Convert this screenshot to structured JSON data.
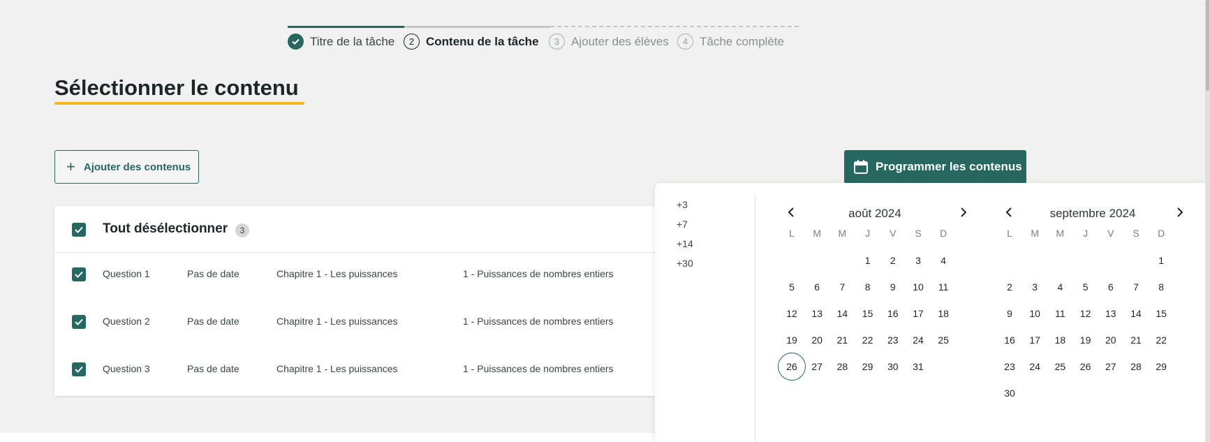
{
  "stepper": {
    "steps": [
      {
        "number": "1",
        "label": "Titre de la tâche",
        "state": "done"
      },
      {
        "number": "2",
        "label": "Contenu de la tâche",
        "state": "active"
      },
      {
        "number": "3",
        "label": "Ajouter des élèves",
        "state": "todo"
      },
      {
        "number": "4",
        "label": "Tâche complète",
        "state": "todo"
      }
    ]
  },
  "page": {
    "title": "Sélectionner le contenu",
    "add_button": "Ajouter des contenus",
    "schedule_button": "Programmer les contenus"
  },
  "table": {
    "header_label": "Tout désélectionner",
    "count": "3",
    "rows": [
      {
        "name": "Question 1",
        "date": "Pas de date",
        "chapter": "Chapitre 1 - Les puissances",
        "section": "1 - Puissances de nombres entiers",
        "checked": true
      },
      {
        "name": "Question 2",
        "date": "Pas de date",
        "chapter": "Chapitre 1 - Les puissances",
        "section": "1 - Puissances de nombres entiers",
        "checked": true
      },
      {
        "name": "Question 3",
        "date": "Pas de date",
        "chapter": "Chapitre 1 - Les puissances",
        "section": "1 - Puissances de nombres entiers",
        "checked": true
      }
    ]
  },
  "calendar": {
    "quick_options": [
      "+3",
      "+7",
      "+14",
      "+30"
    ],
    "weekdays": [
      "L",
      "M",
      "M",
      "J",
      "V",
      "S",
      "D"
    ],
    "months": [
      {
        "title": "août 2024",
        "offset": 3,
        "days": 31,
        "today": 26
      },
      {
        "title": "septembre 2024",
        "offset": 6,
        "days": 30,
        "today": null
      }
    ]
  },
  "colors": {
    "accent": "#276760",
    "underline": "#f2b81f",
    "background": "#f0f1f0"
  }
}
